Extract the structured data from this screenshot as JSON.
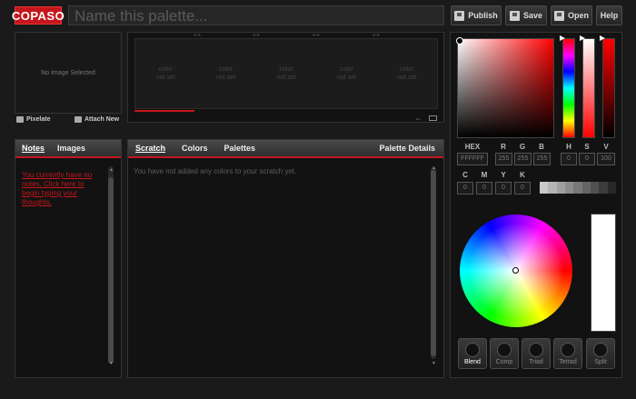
{
  "app": {
    "logo": "COPASO",
    "palette_name_placeholder": "Name this palette..."
  },
  "toolbar": {
    "publish": "Publish",
    "save": "Save",
    "open": "Open",
    "help": "Help"
  },
  "image": {
    "empty_text": "No Image Selected",
    "pixelate": "Pixelate",
    "attach": "Attach New"
  },
  "swatches": [
    {
      "line1": "color",
      "line2": "not set"
    },
    {
      "line1": "color",
      "line2": "not set"
    },
    {
      "line1": "color",
      "line2": "not set"
    },
    {
      "line1": "color",
      "line2": "not set"
    },
    {
      "line1": "color",
      "line2": "not set"
    }
  ],
  "notes": {
    "tabs": [
      "Notes",
      "Images"
    ],
    "text": "You currently have no notes. Click here to begin typing your thoughts."
  },
  "center": {
    "tabs": [
      "Scratch",
      "Colors",
      "Palettes"
    ],
    "details": "Palette Details",
    "empty_text": "You have not added any colors to your scratch yet."
  },
  "picker": {
    "labels": {
      "hex": "HEX",
      "r": "R",
      "g": "G",
      "b": "B",
      "h": "H",
      "s": "S",
      "v": "V",
      "c": "C",
      "m": "M",
      "y": "Y",
      "k": "K"
    },
    "values": {
      "hex": "FFFFFF",
      "r": "255",
      "g": "255",
      "b": "255",
      "h": "0",
      "s": "0",
      "v": "100",
      "c": "0",
      "m": "0",
      "y": "0",
      "k": "0"
    },
    "grays": [
      "#c8c8c8",
      "#b4b4b4",
      "#a0a0a0",
      "#8c8c8c",
      "#787878",
      "#646464",
      "#505050",
      "#3c3c3c",
      "#282828"
    ],
    "modes": [
      "Blend",
      "Comp",
      "Triad",
      "Tetrad",
      "Split"
    ]
  },
  "colors": {
    "accent": "#c4161c"
  }
}
